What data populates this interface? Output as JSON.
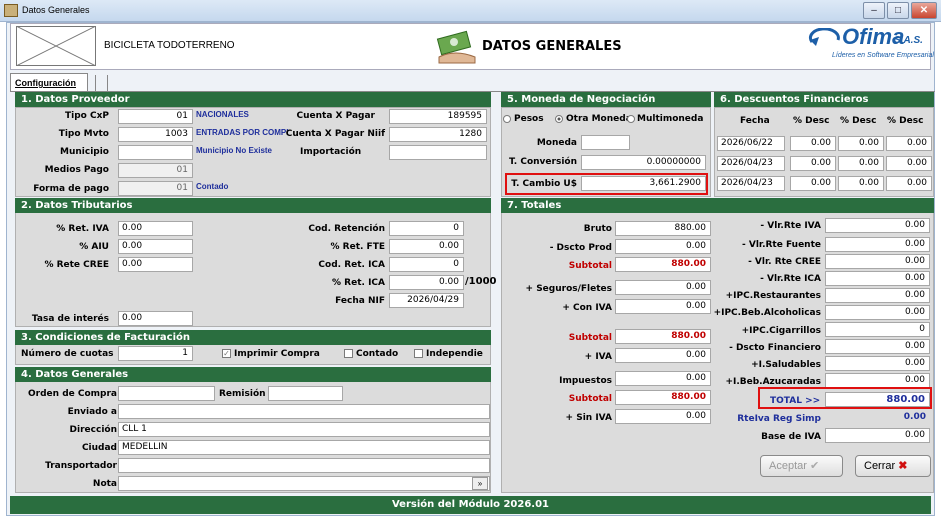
{
  "window": {
    "title": "Datos Generales"
  },
  "header": {
    "product": "BICICLETA TODOTERRENO",
    "title": "DATOS GENERALES",
    "brand": "Ofima",
    "brand_suffix": "S.A.S.",
    "tagline": "Líderes en Software Empresarial"
  },
  "tabs": {
    "config": "Configuración"
  },
  "proveedor": {
    "section": "1. Datos Proveedor",
    "tipo_cxp_label": "Tipo CxP",
    "tipo_cxp": "01",
    "tipo_cxp_desc": "NACIONALES",
    "tipo_mvto_label": "Tipo Mvto",
    "tipo_mvto": "1003",
    "tipo_mvto_desc": "ENTRADAS POR COMPI",
    "municipio_label": "Municipio",
    "municipio_desc": "Municipio No Existe",
    "medios_pago_label": "Medios Pago",
    "medios_pago": "01",
    "forma_pago_label": "Forma de pago",
    "forma_pago": "01",
    "forma_pago_desc": "Contado",
    "cxp_label": "Cuenta X Pagar",
    "cxp": "189595",
    "cxp_niif_label": "Cuenta X Pagar Niif",
    "cxp_niif": "1280",
    "importacion_label": "Importación"
  },
  "tributarios": {
    "section": "2. Datos Tributarios",
    "ret_iva_label": "% Ret. IVA",
    "ret_iva": "0.00",
    "aiu_label": "% AIU",
    "aiu": "0.00",
    "rete_cree_label": "% Rete CREE",
    "rete_cree": "0.00",
    "cod_ret_label": "Cod. Retención",
    "cod_ret": "0",
    "ret_fte_label": "% Ret. FTE",
    "ret_fte": "0.00",
    "cod_ica_label": "Cod. Ret. ICA",
    "cod_ica": "0",
    "ret_ica_label": "% Ret. ICA",
    "ret_ica": "0.00",
    "ret_ica_suffix": "/1000",
    "fecha_niif_label": "Fecha NIF",
    "fecha_niif": "2026/04/29",
    "tasa_label": "Tasa de interés",
    "tasa": "0.00"
  },
  "facturacion": {
    "section": "3. Condiciones de Facturación",
    "cuotas_label": "Número de cuotas",
    "cuotas": "1",
    "imprimir": "Imprimir Compra",
    "contado": "Contado",
    "independie": "Independie"
  },
  "generales": {
    "section": "4. Datos Generales",
    "orden_label": "Orden de Compra",
    "remision_label": "Remisión",
    "enviado_label": "Enviado a",
    "direccion_label": "Dirección",
    "direccion": "CLL 1",
    "ciudad_label": "Ciudad",
    "ciudad": "MEDELLIN",
    "transportador_label": "Transportador",
    "nota_label": "Nota"
  },
  "moneda": {
    "section": "5. Moneda de Negociación",
    "pesos": "Pesos",
    "otra": "Otra Moneda",
    "multi": "Multimoneda",
    "moneda_label": "Moneda",
    "conversion_label": "T. Conversión",
    "conversion": "0.00000000",
    "cambio_label": "T. Cambio U$",
    "cambio": "3,661.2900"
  },
  "descuentos": {
    "section": "6. Descuentos Financieros",
    "h_fecha": "Fecha",
    "h_desc": "% Desc",
    "rows": [
      {
        "fecha": "2026/06/22",
        "d1": "0.00",
        "d2": "0.00",
        "d3": "0.00"
      },
      {
        "fecha": "2026/04/23",
        "d1": "0.00",
        "d2": "0.00",
        "d3": "0.00"
      },
      {
        "fecha": "2026/04/23",
        "d1": "0.00",
        "d2": "0.00",
        "d3": "0.00"
      }
    ]
  },
  "totales": {
    "section": "7. Totales",
    "bruto_label": "Bruto",
    "bruto": "880.00",
    "dscto_prod_label": "- Dscto Prod",
    "dscto_prod": "0.00",
    "subtotal_label": "Subtotal",
    "subtotal1": "880.00",
    "seguros_label": "+ Seguros/Fletes",
    "seguros": "0.00",
    "con_iva_label": "+ Con IVA",
    "con_iva": "0.00",
    "subtotal2": "880.00",
    "iva_label": "+ IVA",
    "iva": "0.00",
    "impuestos_label": "Impuestos",
    "impuestos": "0.00",
    "subtotal3": "880.00",
    "sin_iva_label": "+ Sin IVA",
    "sin_iva": "0.00",
    "right": [
      {
        "label": "- Vlr.Rte IVA",
        "value": "0.00"
      },
      {
        "label": "- Vlr.Rte Fuente",
        "value": "0.00"
      },
      {
        "label": "- Vlr. Rte CREE",
        "value": "0.00"
      },
      {
        "label": "- Vlr.Rte ICA",
        "value": "0.00"
      },
      {
        "label": "+IPC.Restaurantes",
        "value": "0.00"
      },
      {
        "label": "+IPC.Beb.Alcoholicas",
        "value": "0.00"
      },
      {
        "label": "+IPC.Cigarrillos",
        "value": "0"
      },
      {
        "label": "- Dscto Financiero",
        "value": "0.00"
      },
      {
        "label": "+I.Saludables",
        "value": "0.00"
      },
      {
        "label": "+I.Beb.Azucaradas",
        "value": "0.00"
      }
    ],
    "total_label": "TOTAL >>",
    "total": "880.00",
    "rteiva_label": "RteIva Reg Simp",
    "rteiva": "0.00",
    "base_iva_label": "Base de IVA",
    "base_iva": "0.00"
  },
  "actions": {
    "aceptar": "Aceptar",
    "cerrar": "Cerrar"
  },
  "footer": {
    "version": "Versión del Módulo 2026.01"
  }
}
